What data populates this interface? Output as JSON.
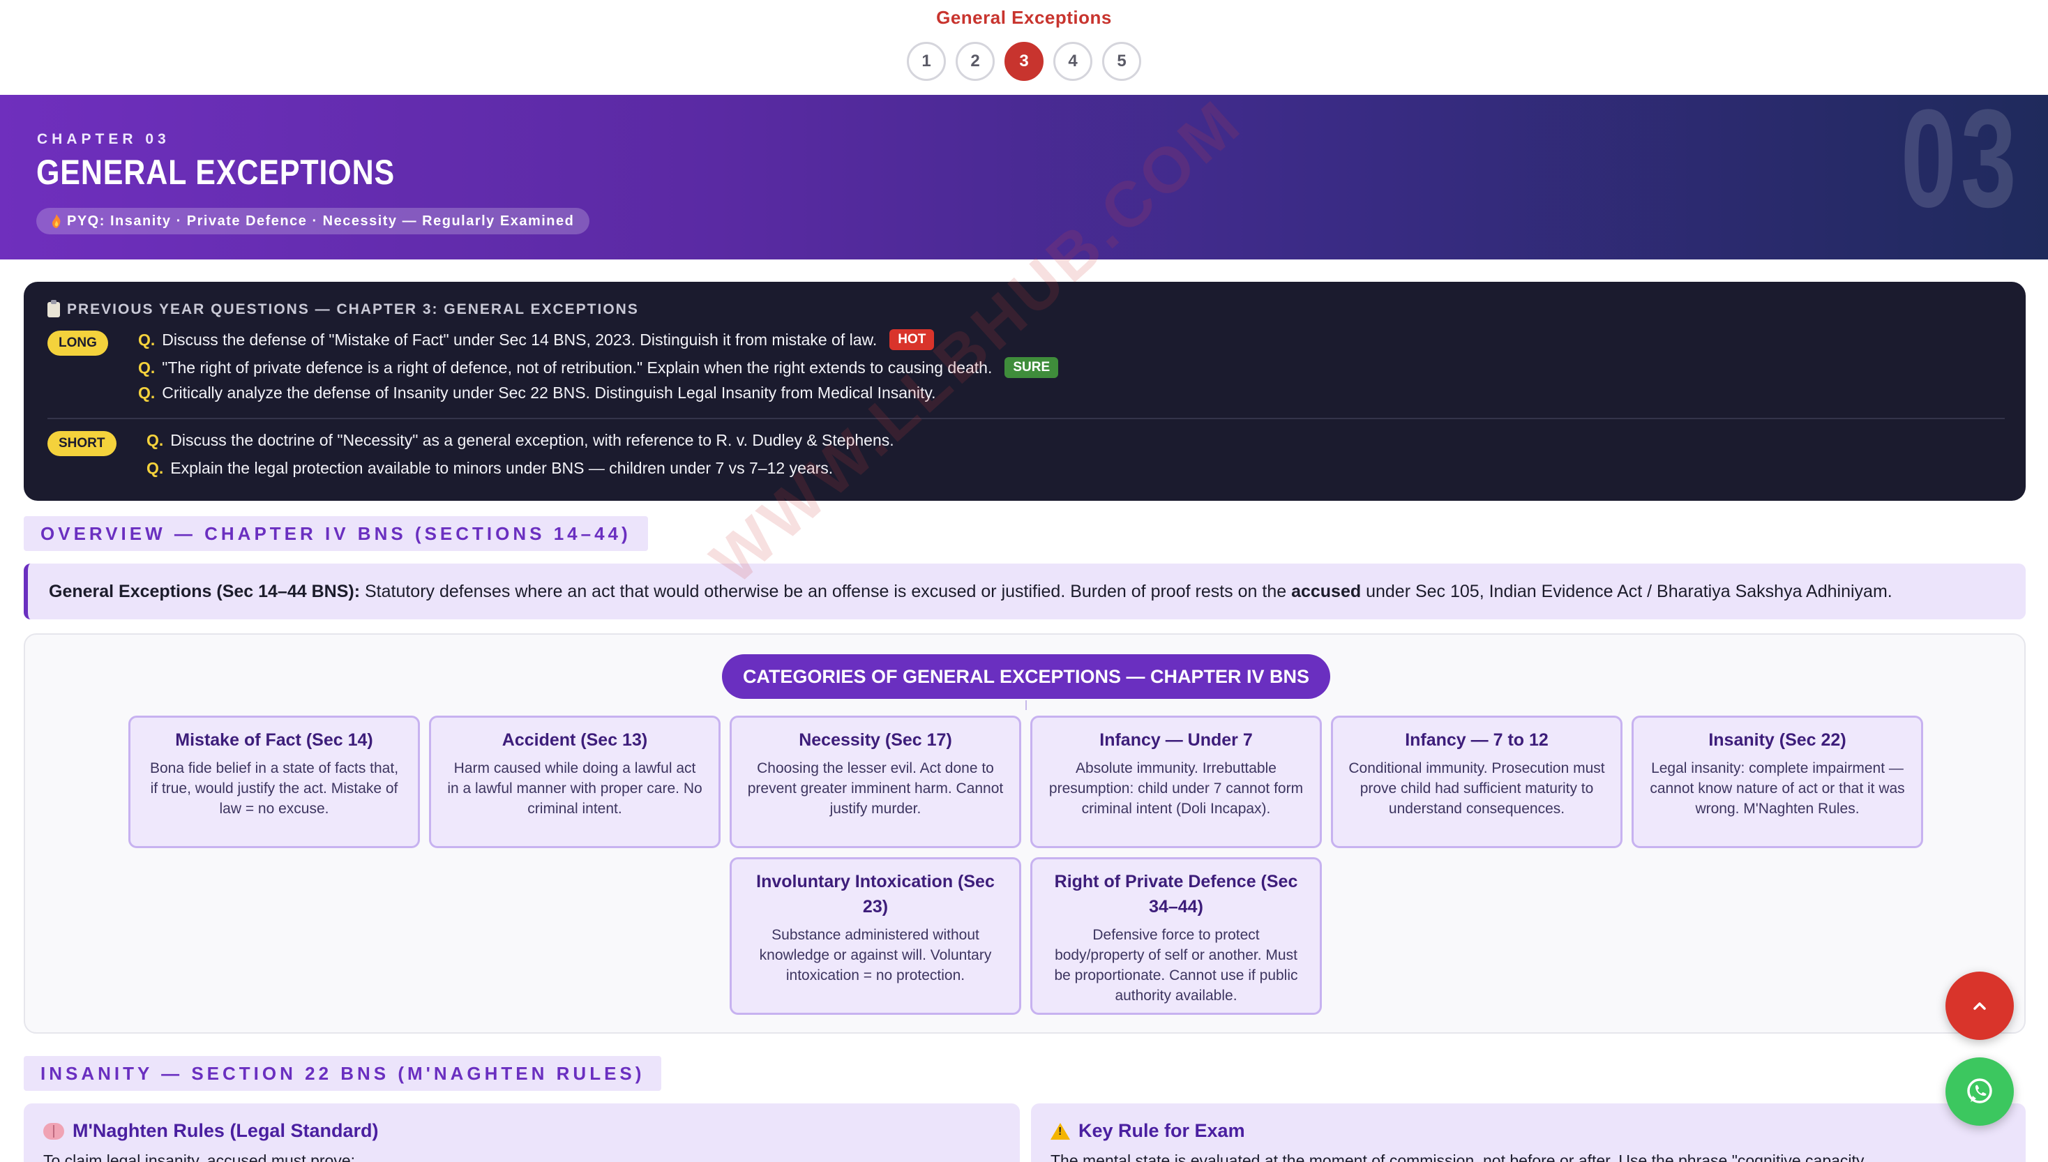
{
  "nav": {
    "title": "General Exceptions",
    "pages": [
      "1",
      "2",
      "3",
      "4",
      "5"
    ],
    "active_page": "3"
  },
  "hero": {
    "kicker": "CHAPTER 03",
    "title": "GENERAL EXCEPTIONS",
    "pyq_pill": "PYQ: Insanity · Private Defence · Necessity — Regularly Examined",
    "big_number": "03"
  },
  "pyq": {
    "heading": "PREVIOUS YEAR QUESTIONS — CHAPTER 3: GENERAL EXCEPTIONS",
    "long_tag": "LONG",
    "short_tag": "SHORT",
    "q_mark": "Q.",
    "long": [
      {
        "text": "Discuss the defense of \"Mistake of Fact\" under Sec 14 BNS, 2023. Distinguish it from mistake of law.",
        "badge": "HOT"
      },
      {
        "text": "\"The right of private defence is a right of defence, not of retribution.\" Explain when the right extends to causing death.",
        "badge": "SURE"
      },
      {
        "text": "Critically analyze the defense of Insanity under Sec 22 BNS. Distinguish Legal Insanity from Medical Insanity.",
        "badge": ""
      }
    ],
    "short": [
      {
        "text": "Discuss the doctrine of \"Necessity\" as a general exception, with reference to R. v. Dudley & Stephens."
      },
      {
        "text": "Explain the legal protection available to minors under BNS — children under 7 vs 7–12 years."
      }
    ]
  },
  "overview": {
    "header": "OVERVIEW — CHAPTER IV BNS (SECTIONS 14–44)",
    "lead": "General Exceptions (Sec 14–44 BNS):",
    "text_before": " Statutory defenses where an act that would otherwise be an offense is excused or justified. Burden of proof rests on the ",
    "emphasis": "accused",
    "text_after": " under Sec 105, Indian Evidence Act / Bharatiya Sakshya Adhiniyam."
  },
  "diagram": {
    "root": "CATEGORIES OF GENERAL EXCEPTIONS — CHAPTER IV BNS",
    "cards": [
      {
        "title": "Mistake of Fact (Sec 14)",
        "body": "Bona fide belief in a state of facts that, if true, would justify the act. Mistake of law = no excuse."
      },
      {
        "title": "Accident (Sec 13)",
        "body": "Harm caused while doing a lawful act in a lawful manner with proper care. No criminal intent."
      },
      {
        "title": "Necessity (Sec 17)",
        "body": "Choosing the lesser evil. Act done to prevent greater imminent harm. Cannot justify murder."
      },
      {
        "title": "Infancy — Under 7",
        "body": "Absolute immunity. Irrebuttable presumption: child under 7 cannot form criminal intent (Doli Incapax)."
      },
      {
        "title": "Infancy — 7 to 12",
        "body": "Conditional immunity. Prosecution must prove child had sufficient maturity to understand consequences."
      },
      {
        "title": "Insanity (Sec 22)",
        "body": "Legal insanity: complete impairment — cannot know nature of act or that it was wrong. M'Naghten Rules."
      },
      {
        "title": "Involuntary Intoxication (Sec 23)",
        "body": "Substance administered without knowledge or against will. Voluntary intoxication = no protection."
      },
      {
        "title": "Right of Private Defence (Sec 34–44)",
        "body": "Defensive force to protect body/property of self or another. Must be proportionate. Cannot use if public authority available."
      }
    ]
  },
  "insanity": {
    "header": "INSANITY — SECTION 22 BNS (M'NAGHTEN RULES)",
    "left_title": "M'Naghten Rules (Legal Standard)",
    "left_text": "To claim legal insanity, accused must prove:",
    "right_title": "Key Rule for Exam",
    "right_text": "The mental state is evaluated at the moment of commission, not before or after. Use the phrase \"cognitive capacity"
  },
  "watermark": "WWW.LLBHUB.COM",
  "colors": {
    "accent": "#6a2fc0",
    "nav_active": "#c8342e",
    "hot": "#d9342b",
    "sure": "#3f8d3b",
    "tag_yellow": "#f4d23c",
    "whatsapp": "#3cc75f"
  },
  "icons": {
    "scroll_top": "chevron-up-icon",
    "whatsapp": "whatsapp-icon",
    "clipboard": "clipboard-icon",
    "fire": "fire-icon",
    "brain": "brain-icon",
    "warning": "warning-icon"
  }
}
